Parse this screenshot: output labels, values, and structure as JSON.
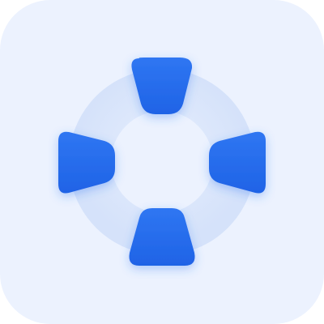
{
  "app_icon": {
    "icon": "lifebuoy-icon",
    "colors": {
      "tile_background": "#ECF2FE",
      "ring_light": "#DCE7FC",
      "ring_shade": "#D3E0F9",
      "segment_blue": "#2F76F2",
      "segment_blue_dark": "#1F63E6",
      "segment_shadow": "#2F76F2"
    }
  }
}
